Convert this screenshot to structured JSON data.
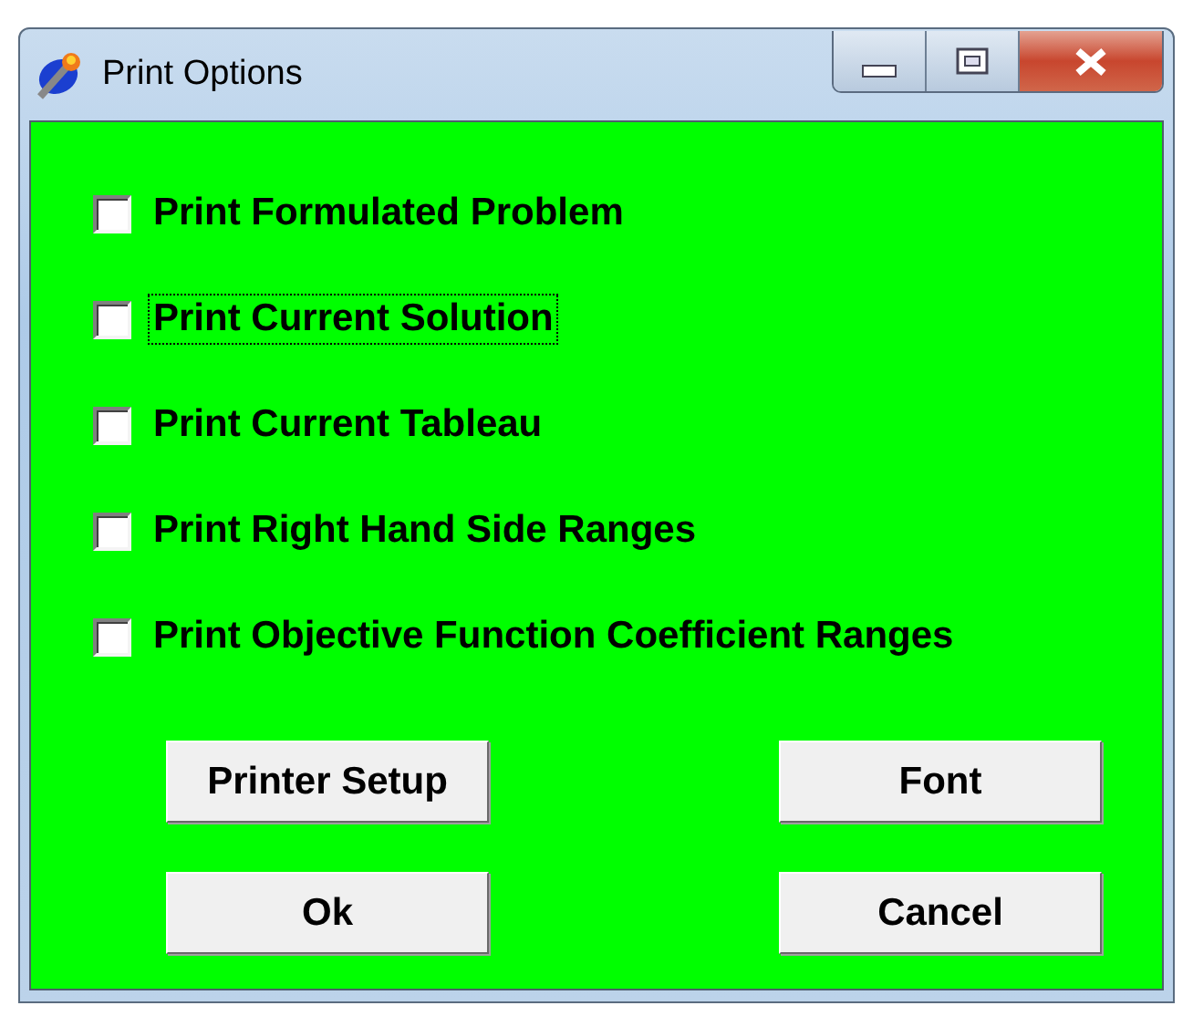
{
  "window": {
    "title": "Print Options"
  },
  "options": [
    {
      "label": "Print Formulated Problem",
      "checked": false,
      "focused": false
    },
    {
      "label": "Print Current Solution",
      "checked": false,
      "focused": true
    },
    {
      "label": "Print Current Tableau",
      "checked": false,
      "focused": false
    },
    {
      "label": "Print Right Hand Side Ranges",
      "checked": false,
      "focused": false
    },
    {
      "label": "Print Objective Function Coefficient Ranges",
      "checked": false,
      "focused": false
    }
  ],
  "buttons": [
    {
      "label": "Printer Setup"
    },
    {
      "label": "Font"
    },
    {
      "label": "Ok"
    },
    {
      "label": "Cancel"
    }
  ]
}
